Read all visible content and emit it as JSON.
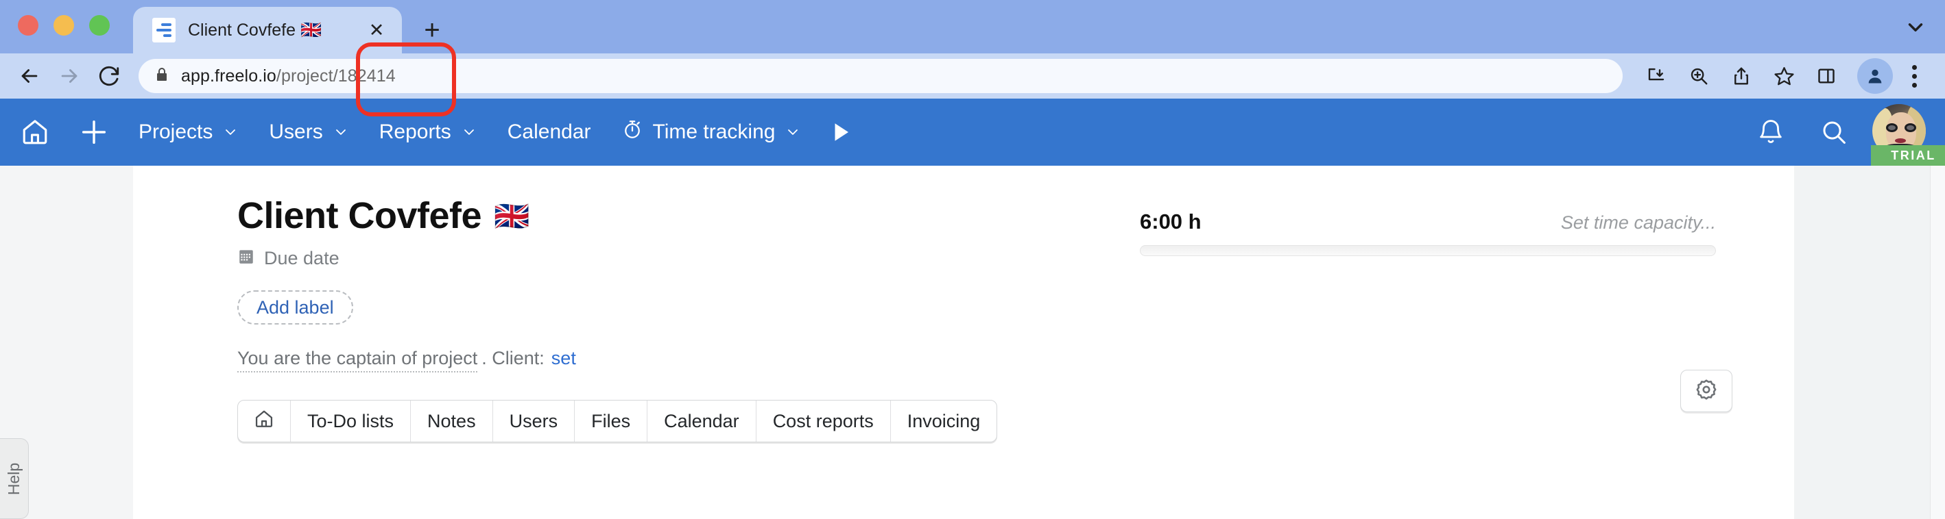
{
  "window": {
    "traffic_lights": [
      "close",
      "minimize",
      "maximize"
    ]
  },
  "browser": {
    "tab": {
      "title": "Client Covfefe 🇬🇧",
      "favicon": "freelo-icon",
      "close_label": "✕"
    },
    "new_tab_label": "+",
    "tab_list_chevron": "chevron-down-icon",
    "nav": {
      "back": "back-arrow-icon",
      "forward": "forward-arrow-icon",
      "reload": "reload-icon"
    },
    "omnibox": {
      "lock": "lock-icon",
      "url_host": "app.freelo.io",
      "url_path": "/project",
      "url_id": "/182414",
      "full_url": "app.freelo.io/project/182414"
    },
    "toolbar_icons": [
      "install-download-icon",
      "zoom-search-icon",
      "share-icon",
      "bookmark-star-icon",
      "side-panel-icon"
    ],
    "profile_icon": "profile-avatar-icon",
    "menu_icon": "three-dot-menu-icon"
  },
  "annotation": {
    "type": "red-rounded-rect-highlight",
    "color": "#ee3124",
    "target": "/182414"
  },
  "appnav": {
    "home_icon": "home-icon",
    "add_icon": "plus-icon",
    "items": [
      {
        "label": "Projects",
        "chevron": true
      },
      {
        "label": "Users",
        "chevron": true
      },
      {
        "label": "Reports",
        "chevron": true
      },
      {
        "label": "Calendar",
        "chevron": false
      },
      {
        "label": "Time tracking",
        "chevron": true,
        "icon": "stopwatch-icon"
      }
    ],
    "play_icon": "play-triangle-icon",
    "bell_icon": "notification-bell-icon",
    "search_icon": "search-icon",
    "avatar": "user-avatar-photo",
    "trial_badge": "TRIAL",
    "background_color": "#3576ce"
  },
  "page": {
    "help_tab": "Help",
    "title": "Client Covfefe",
    "title_flag": "🇬🇧",
    "due_date": {
      "icon": "calendar-icon",
      "label": "Due date"
    },
    "add_label_button": "Add label",
    "captain_text": "You are the captain of project",
    "client_prefix": ". Client:",
    "client_link": "set",
    "tabs": [
      {
        "label": "",
        "icon": "home-icon"
      },
      {
        "label": "To-Do lists"
      },
      {
        "label": "Notes"
      },
      {
        "label": "Users"
      },
      {
        "label": "Files"
      },
      {
        "label": "Calendar"
      },
      {
        "label": "Cost reports"
      },
      {
        "label": "Invoicing"
      }
    ],
    "capacity": {
      "hours": "6:00 h",
      "set_placeholder": "Set time capacity...",
      "progress_percent": 0
    },
    "settings_icon": "gear-icon"
  },
  "colors": {
    "accent_blue": "#3576ce",
    "link_blue": "#2f6ed1",
    "trial_green": "#6ab667",
    "annotation_red": "#ee3124"
  }
}
